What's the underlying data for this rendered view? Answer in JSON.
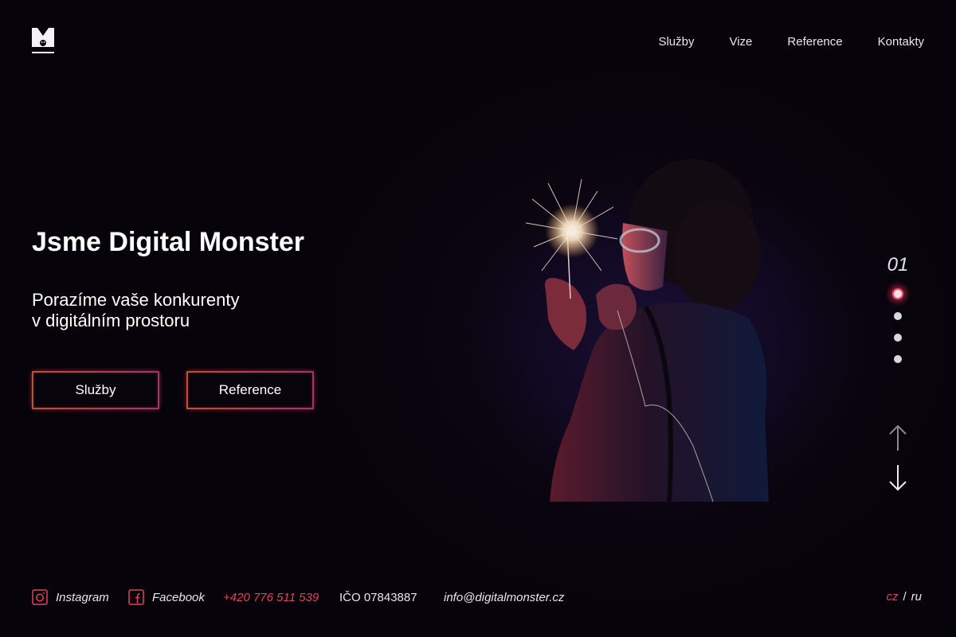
{
  "header": {
    "logo_alt": "M",
    "nav": [
      "Služby",
      "Vize",
      "Reference",
      "Kontakty"
    ]
  },
  "hero": {
    "title": "Jsme Digital Monster",
    "subtitle_lines": [
      "Porazíme vaše konkurenty",
      "v digitálním prostoru"
    ],
    "buttons": [
      "Služby",
      "Reference"
    ]
  },
  "slider": {
    "current": "01",
    "total_dots": 4,
    "active_index": 0
  },
  "footer": {
    "instagram": "Instagram",
    "facebook": "Facebook",
    "phone": "+420 776 511 539",
    "ico": "IČO 07843887",
    "email": "info@digitalmonster.cz"
  },
  "languages": {
    "cz": "cz",
    "separator": "/",
    "ru": "ru"
  },
  "colors": {
    "background": "#07030a",
    "accent": "#e0435f",
    "button_border": "#b2455a"
  }
}
